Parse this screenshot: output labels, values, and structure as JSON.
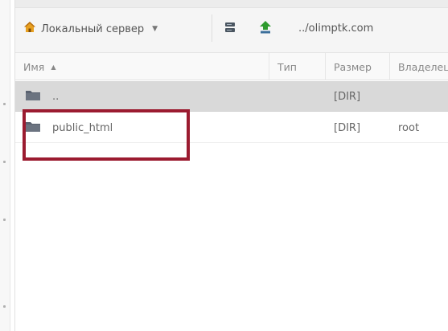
{
  "toolbar": {
    "server_label": "Локальный сервер",
    "path": "../olimptk.com"
  },
  "columns": [
    "Имя",
    "Тип",
    "Размер",
    "Владелец"
  ],
  "rows": [
    {
      "name": "..",
      "type": "",
      "size": "[DIR]",
      "owner": ""
    },
    {
      "name": "public_html",
      "type": "",
      "size": "[DIR]",
      "owner": "root"
    }
  ],
  "colors": {
    "selected_row": "#d9d9d9",
    "highlight_border": "#9b1b30",
    "home_icon": "#e8a020",
    "upload_icon": "#2e9b2e",
    "folder_icon": "#5a6270"
  },
  "icons": [
    "home-icon",
    "server-icon",
    "upload-arrow-icon",
    "folder-icon"
  ]
}
